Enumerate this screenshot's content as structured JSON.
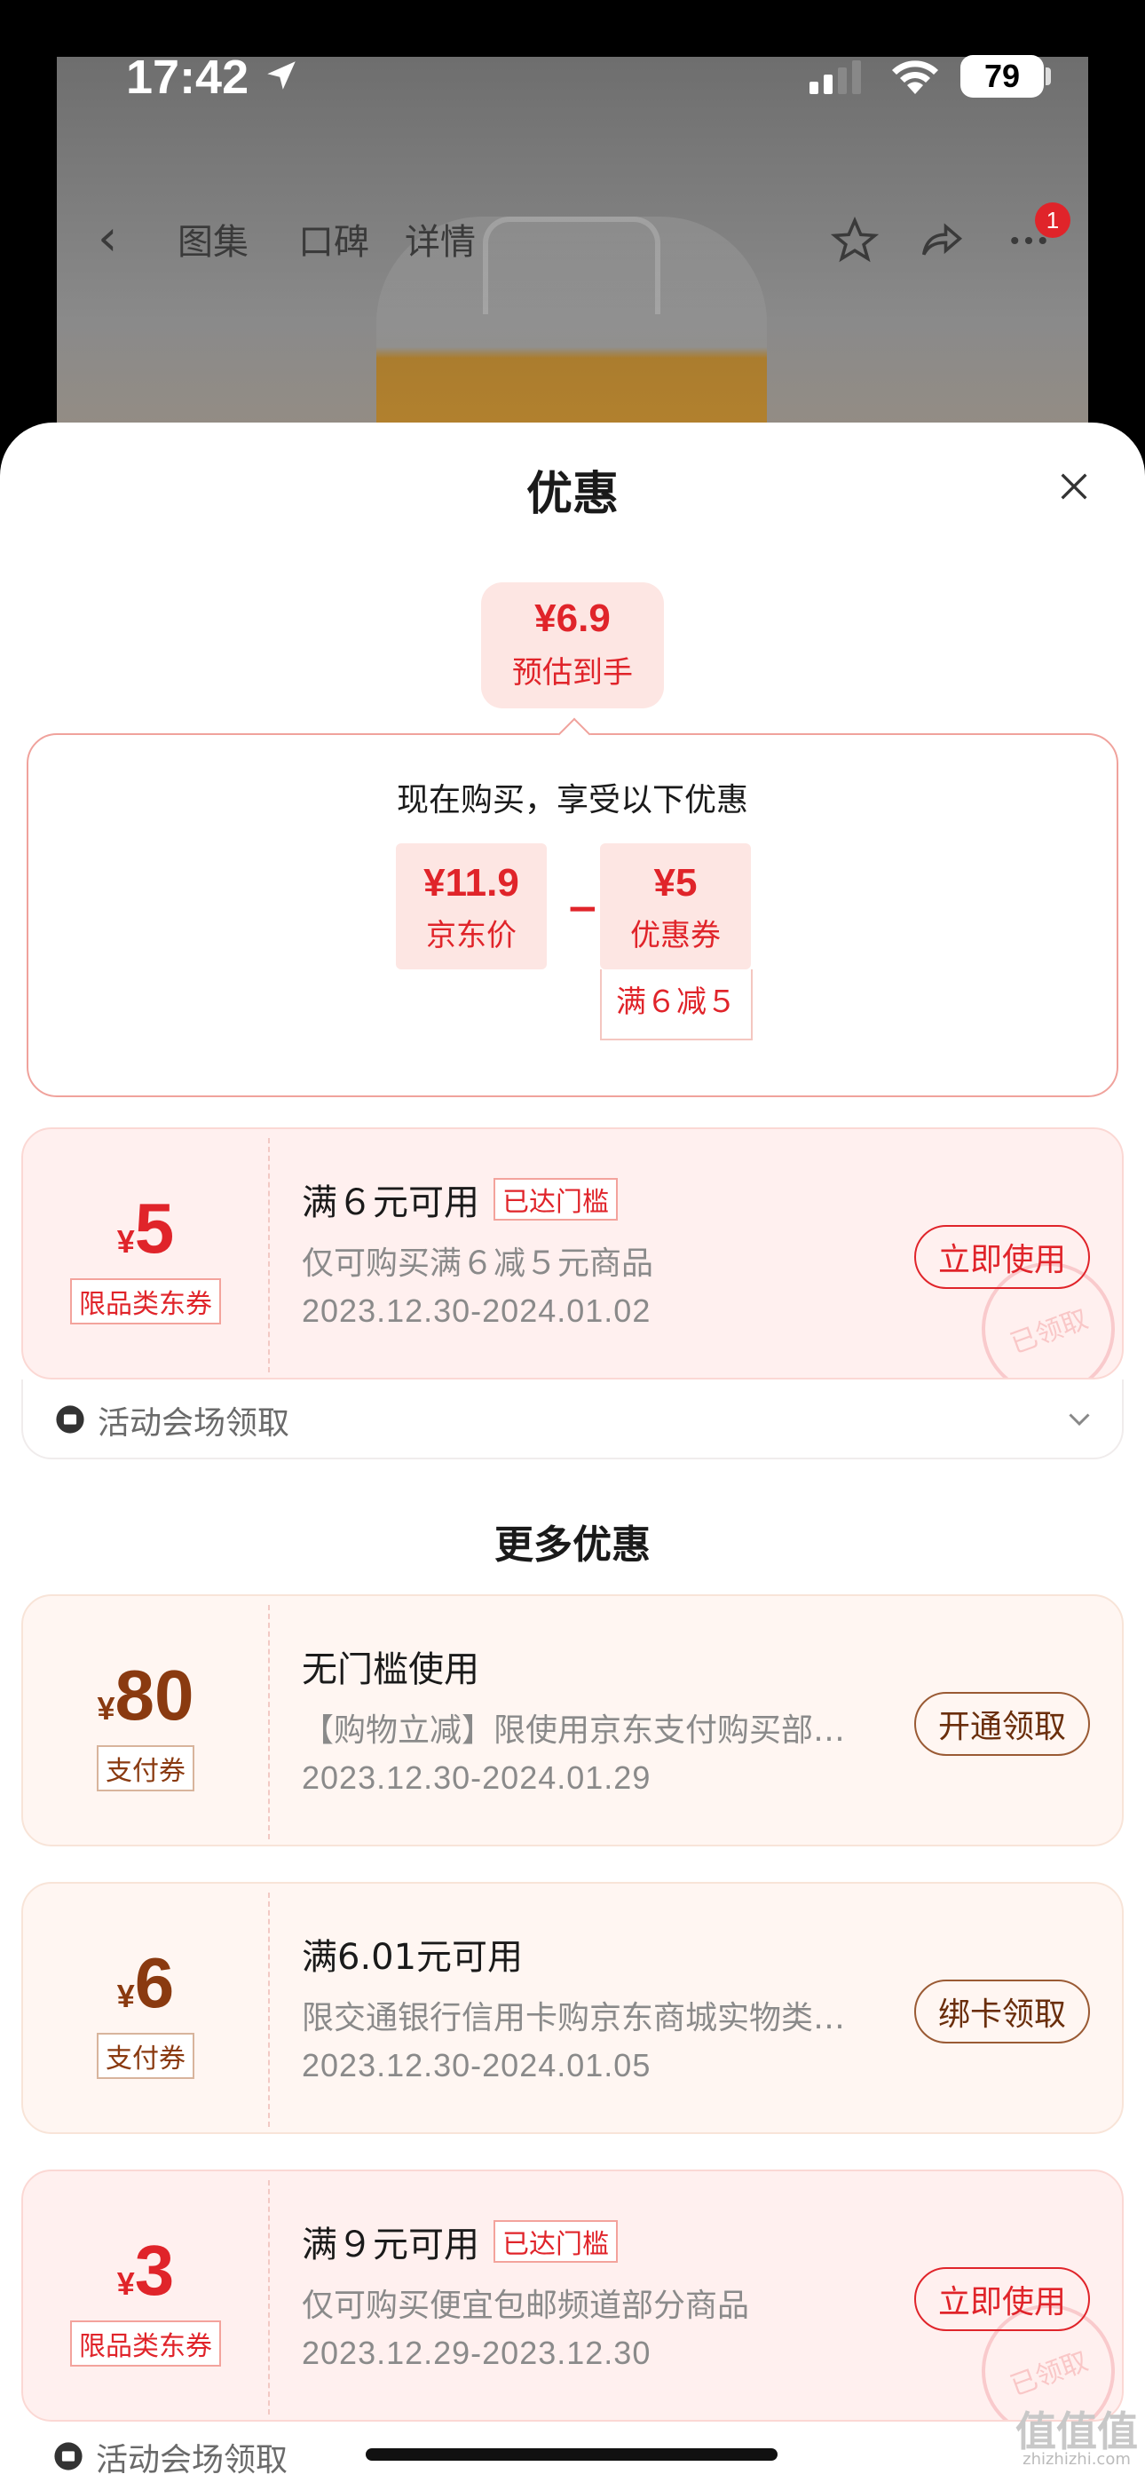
{
  "status_bar": {
    "time": "17:42",
    "battery": "79"
  },
  "nav": {
    "tabs": [
      "图集",
      "口碑",
      "详情"
    ],
    "badge_count": "1"
  },
  "sheet": {
    "title": "优惠",
    "estimate": {
      "price": "¥6.9",
      "label": "预估到手"
    },
    "breakdown": {
      "heading": "现在购买，享受以下优惠",
      "jd_price": {
        "value": "¥11.9",
        "label": "京东价"
      },
      "operator": "−",
      "coupon": {
        "value": "¥5",
        "label": "优惠券"
      },
      "rule": "满６减５"
    }
  },
  "coupons_main": [
    {
      "currency": "¥",
      "amount": "5",
      "tag": "限品类东券",
      "title": "满６元可用",
      "reached": "已达门槛",
      "desc": "仅可购买满６减５元商品",
      "date": "2023.12.30-2024.01.02",
      "button": "立即使用",
      "stamp": "已领取",
      "footer": "活动会场领取"
    }
  ],
  "more_title": "更多优惠",
  "coupons_more": [
    {
      "currency": "¥",
      "amount": "80",
      "tag": "支付券",
      "title": "无门槛使用",
      "desc": "【购物立减】限使用京东支付购买部分商品",
      "date": "2023.12.30-2024.01.29",
      "button": "开通领取"
    },
    {
      "currency": "¥",
      "amount": "6",
      "tag": "支付券",
      "title": "满6.01元可用",
      "desc": "限交通银行信用卡购京东商城实物类商品",
      "date": "2023.12.30-2024.01.05",
      "button": "绑卡领取"
    },
    {
      "currency": "¥",
      "amount": "3",
      "tag": "限品类东券",
      "title": "满９元可用",
      "reached": "已达门槛",
      "desc": "仅可购买便宜包邮频道部分商品",
      "date": "2023.12.29-2023.12.30",
      "button": "立即使用",
      "stamp": "已领取",
      "footer": "活动会场领取"
    }
  ],
  "watermark": {
    "text": "值值值",
    "sub": "zhizhizhi.com"
  },
  "colors": {
    "accent": "#e0242a",
    "tan": "#8a3a10",
    "pink_bg": "#fde6e3"
  }
}
